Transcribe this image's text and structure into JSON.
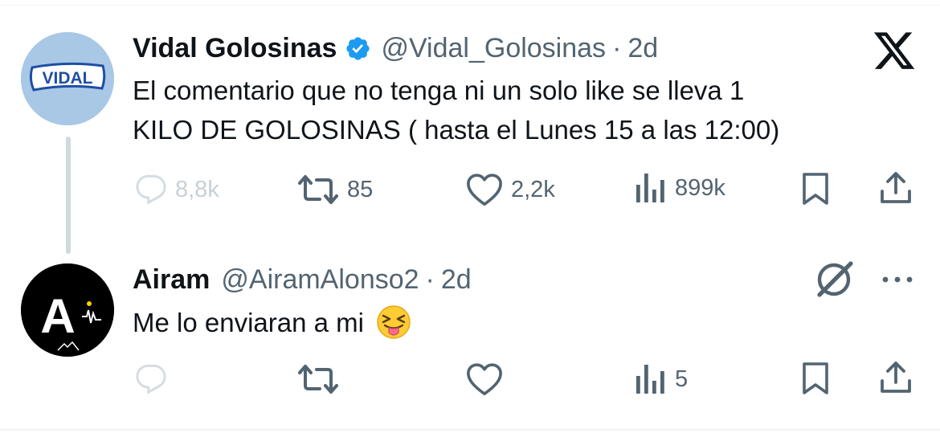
{
  "tweet": {
    "author_name": "Vidal Golosinas",
    "handle": "@Vidal_Golosinas",
    "separator": "·",
    "time": "2d",
    "avatar_text": "VIDAL",
    "text_line1": "El comentario que no tenga ni un solo like se lleva 1",
    "text_line2": "KILO DE GOLOSINAS ( hasta el Lunes 15 a las 12:00)",
    "replies": "8,8k",
    "retweets": "85",
    "likes": "2,2k",
    "views": "899k"
  },
  "reply": {
    "author_name": "Airam",
    "handle": "@AiramAlonso2",
    "separator": "·",
    "time": "2d",
    "avatar_text": "A",
    "text": "Me lo enviaran a mi",
    "emoji": "squinting-face-with-tongue",
    "views": "5"
  },
  "icons": {
    "platform": "x-logo",
    "verified": "verified-badge-icon",
    "grok": "grok-icon",
    "more": "more-icon"
  },
  "colors": {
    "text": "#0f1419",
    "muted": "#536471",
    "verified_blue": "#1d9bf0",
    "divider": "#eff3f4",
    "thread_line": "#cfd9de"
  }
}
